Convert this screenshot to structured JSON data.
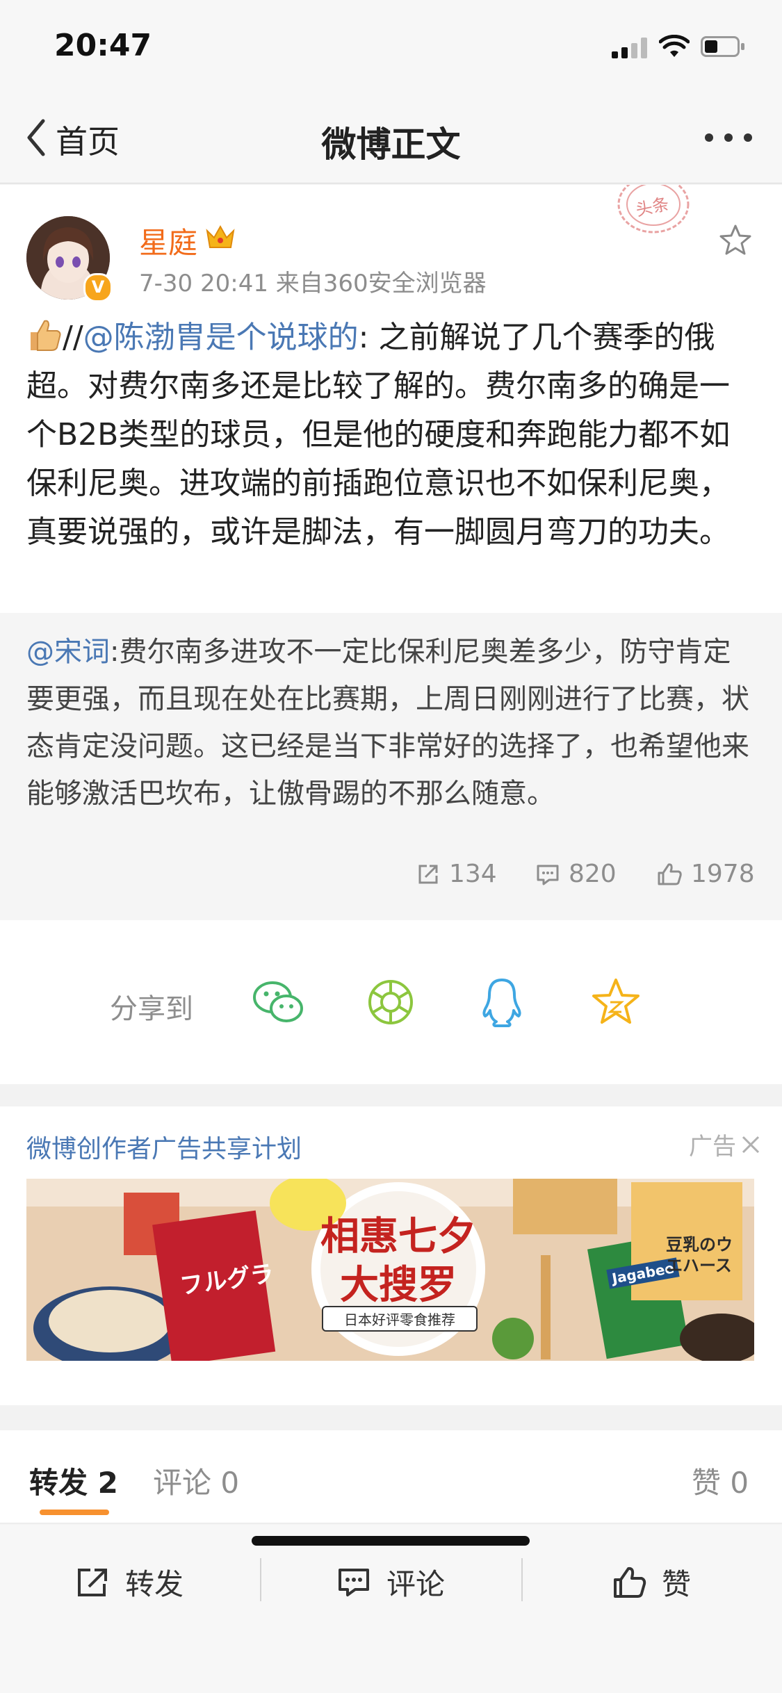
{
  "status_bar": {
    "time": "20:47"
  },
  "nav": {
    "back_label": "首页",
    "title": "微博正文"
  },
  "post": {
    "username": "星庭",
    "meta": "7-30 20:41  来自360安全浏览器",
    "stamp": "头条",
    "text_prefix": "//",
    "mention": "@陈渤胄是个说球的",
    "text": ": 之前解说了几个赛季的俄超。对费尔南多还是比较了解的。费尔南多的确是一个B2B类型的球员，但是他的硬度和奔跑能力都不如保利尼奥。进攻端的前插跑位意识也不如保利尼奥，真要说强的，或许是脚法，有一脚圆月弯刀的功夫。",
    "quote_mention": "@宋词",
    "quote_text": ":费尔南多进攻不一定比保利尼奥差多少，防守肯定要更强，而且现在处在比赛期，上周日刚刚进行了比赛，状态肯定没问题。这已经是当下非常好的选择了，也希望他来能够激活巴坎布，让傲骨踢的不那么随意。",
    "reposts": "134",
    "comments": "820",
    "likes": "1978"
  },
  "share": {
    "label": "分享到"
  },
  "ad": {
    "title": "微博创作者广告共享计划",
    "label": "广告",
    "banner_title_1": "相惠七夕",
    "banner_title_2": "大搜罗",
    "banner_subtitle": "日本好评零食推荐",
    "product_1": "フルグラ",
    "product_2": "Jagabee",
    "product_3": "豆乳のウエハース"
  },
  "tabs": {
    "reposts": "转发 2",
    "comments": "评论 0",
    "likes": "赞 0"
  },
  "bottom_bar": {
    "repost": "转发",
    "comment": "评论",
    "like": "赞"
  },
  "colors": {
    "accent_orange": "#f26b1a",
    "link_blue": "#4a78b4",
    "tab_indicator": "#f7912f"
  }
}
